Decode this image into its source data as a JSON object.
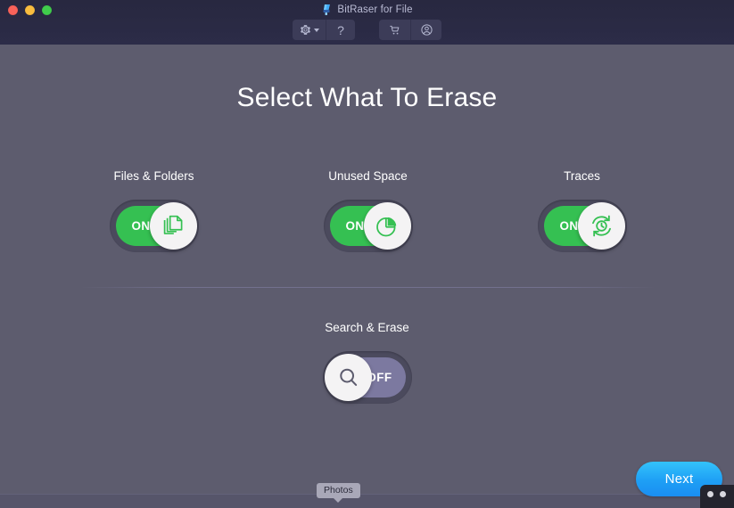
{
  "window": {
    "app_title": "BitRaser for File",
    "app_icon": "bitraser-app-icon",
    "controls": {
      "close": "close-window",
      "minimize": "minimize-window",
      "zoom": "zoom-window"
    }
  },
  "toolbar": {
    "settings": {
      "icon": "gear-icon",
      "caret": "chevron-down-icon",
      "label": ""
    },
    "help": {
      "icon": "question-mark-icon",
      "label": "?"
    },
    "cart": {
      "icon": "shopping-cart-icon",
      "label": ""
    },
    "account": {
      "icon": "user-account-icon",
      "label": ""
    }
  },
  "main": {
    "page_title": "Select What To Erase",
    "toggles_top": [
      {
        "label": "Files & Folders",
        "state": "ON",
        "enabled": true,
        "icon": "documents-stack-icon"
      },
      {
        "label": "Unused Space",
        "state": "ON",
        "enabled": true,
        "icon": "pie-chart-icon"
      },
      {
        "label": "Traces",
        "state": "ON",
        "enabled": true,
        "icon": "history-refresh-clock-icon"
      }
    ],
    "toggles_bottom": [
      {
        "label": "Search & Erase",
        "state": "OFF",
        "enabled": false,
        "icon": "magnifier-search-icon"
      }
    ]
  },
  "footer": {
    "tooltip": "Photos",
    "next_label": "Next"
  },
  "colors": {
    "titlebar": "#2a2a44",
    "body": "#5d5c6e",
    "toggle_on": "#35c052",
    "toggle_off": "#7c79a0",
    "toggle_frame": "#4b4a5d",
    "knob": "#f4f3f4",
    "accent_next": "#1e9ff5",
    "text": "#ffffff"
  }
}
